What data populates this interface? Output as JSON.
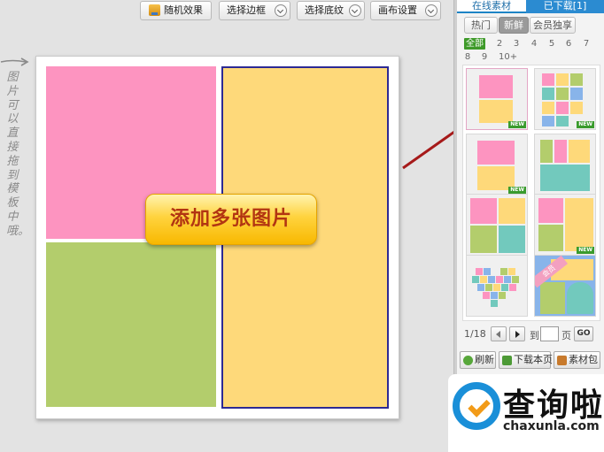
{
  "toolbar": {
    "random_label": "随机效果",
    "border_label": "选择边框",
    "texture_label": "选择底纹",
    "canvas_label": "画布设置"
  },
  "hint": {
    "text": "图片可以直接拖到模板中哦。"
  },
  "canvas": {
    "add_label": "添加多张图片",
    "cells": [
      {
        "name": "pink",
        "color": "#fd94c0"
      },
      {
        "name": "green",
        "color": "#b3cd6c"
      },
      {
        "name": "yellow",
        "color": "#fed97a",
        "selected": true
      }
    ]
  },
  "panel": {
    "tabs": [
      {
        "label": "在线素材",
        "active": true
      },
      {
        "label": "已下载[1]",
        "active": false
      }
    ],
    "categories": [
      {
        "label": "热门"
      },
      {
        "label": "新鲜",
        "active": true
      },
      {
        "label": "会员独享"
      }
    ],
    "counts": [
      "全部",
      "2",
      "3",
      "4",
      "5",
      "6",
      "7",
      "8",
      "9",
      "10+"
    ],
    "thumbnails": [
      {
        "name": "template-pink-yellow",
        "new": true,
        "selected": true
      },
      {
        "name": "template-color-grid",
        "new": true
      },
      {
        "name": "template-two-stack",
        "new": true
      },
      {
        "name": "template-three-block",
        "new": false
      },
      {
        "name": "template-four-grid",
        "new": false
      },
      {
        "name": "template-three-col",
        "new": true
      },
      {
        "name": "template-heart-mosaic",
        "new": false
      },
      {
        "name": "template-vip-heart",
        "new": false,
        "badge": "会员"
      }
    ],
    "new_badge": "NEW",
    "pager": {
      "current": "1/18",
      "to_label": "到",
      "page_label": "页",
      "go_label": "GO"
    },
    "actions": {
      "refresh": "刷新",
      "download_page": "下载本页",
      "material_pack": "素材包"
    }
  },
  "watermark": {
    "title": "查询啦",
    "url": "chaxunla.com"
  },
  "colors": {
    "accent_blue": "#2b8bd1",
    "new_green": "#3a9b2d",
    "add_text": "#b23512",
    "arrow_red": "#a61a1a"
  }
}
